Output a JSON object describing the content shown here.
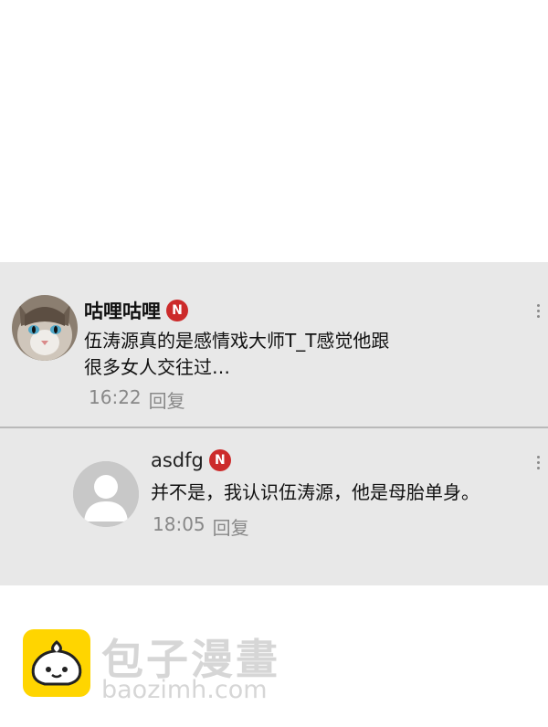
{
  "comments": [
    {
      "username": "咕哩咕哩",
      "badge": "N",
      "text_line1": "伍涛源真的是感情戏大师T_T感觉他跟",
      "text_line2": "很多女人交往过…",
      "time": "16:22",
      "reply_label": "回复"
    },
    {
      "username": "asdfg",
      "badge": "N",
      "text_line1": "并不是，我认识伍涛源，他是母胎单身。",
      "time": "18:05",
      "reply_label": "回复"
    }
  ],
  "watermark": {
    "title": "包子漫畫",
    "url": "baozimh.com"
  },
  "colors": {
    "panel_bg": "#e8e8e8",
    "badge_red": "#cc2b2b",
    "meta_gray": "#888888",
    "logo_yellow": "#ffd500"
  }
}
